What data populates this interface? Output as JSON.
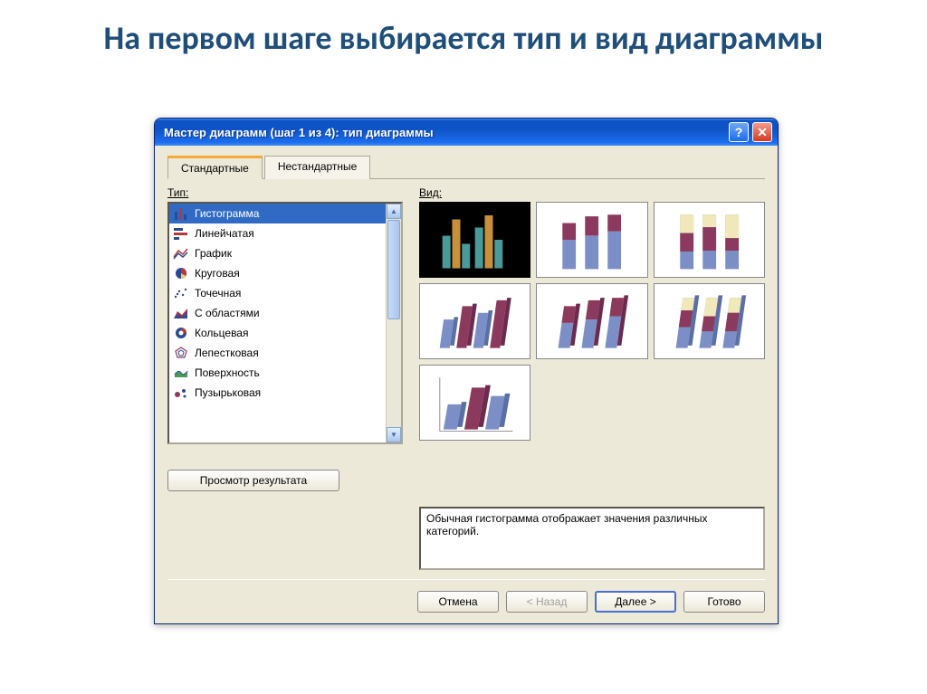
{
  "slide": {
    "title": "На первом шаге выбирается тип и вид диаграммы"
  },
  "window": {
    "title": "Мастер диаграмм (шаг 1 из 4): тип диаграммы",
    "help": "?",
    "close": "✕"
  },
  "tabs": {
    "standard": "Стандартные",
    "nonstandard": "Нестандартные"
  },
  "labels": {
    "type": "Тип:",
    "view": "Вид:"
  },
  "types": [
    {
      "label": "Гистограмма",
      "selected": true
    },
    {
      "label": "Линейчатая"
    },
    {
      "label": "График"
    },
    {
      "label": "Круговая"
    },
    {
      "label": "Точечная"
    },
    {
      "label": "С областями"
    },
    {
      "label": "Кольцевая"
    },
    {
      "label": "Лепестковая"
    },
    {
      "label": "Поверхность"
    },
    {
      "label": "Пузырьковая"
    }
  ],
  "description": "Обычная гистограмма отображает значения различных категорий.",
  "buttons": {
    "preview": "Просмотр результата",
    "cancel": "Отмена",
    "back": "< Назад",
    "next": "Далее >",
    "finish": "Готово"
  },
  "colors": {
    "accent": "#316ac5",
    "bar1": "#7b8fc6",
    "bar2": "#8b3a5e",
    "bar3": "#f0e8b8"
  }
}
